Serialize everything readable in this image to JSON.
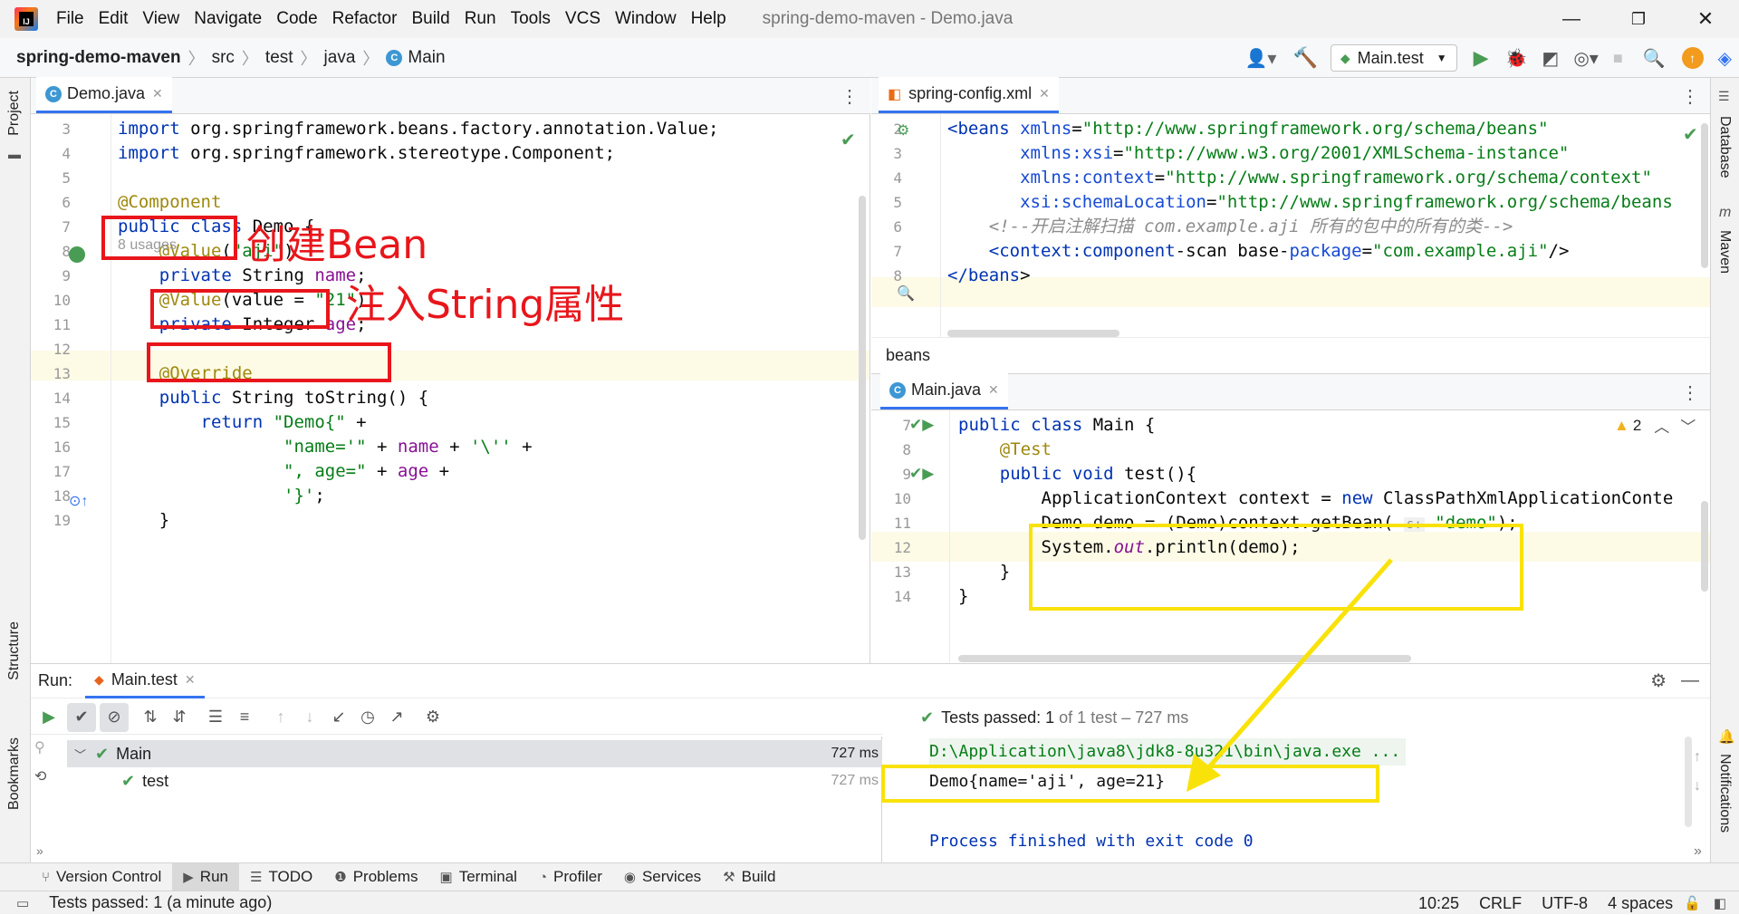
{
  "title_bar": {
    "menu": [
      "File",
      "Edit",
      "View",
      "Navigate",
      "Code",
      "Refactor",
      "Build",
      "Run",
      "Tools",
      "VCS",
      "Window",
      "Help"
    ],
    "window_title": "spring-demo-maven - Demo.java"
  },
  "nav_bar": {
    "project": "spring-demo-maven",
    "crumbs": [
      "src",
      "test",
      "java",
      "Main"
    ],
    "run_config": "Main.test"
  },
  "side_stripes": {
    "left": [
      "Project",
      "Structure",
      "Bookmarks"
    ],
    "right": [
      "Database",
      "Maven",
      "Notifications"
    ]
  },
  "left_editor": {
    "tab": "Demo.java",
    "usages": "8 usages",
    "lines": [
      {
        "n": "3",
        "code": "import org.springframework.beans.factory.annotation.Value;"
      },
      {
        "n": "4",
        "code": "import org.springframework.stereotype.Component;"
      },
      {
        "n": "5",
        "code": ""
      },
      {
        "n": "6",
        "code": "@Component"
      },
      {
        "n": "7",
        "code": "public class Demo {"
      },
      {
        "n": "8",
        "code": "    @Value(\"aji\")"
      },
      {
        "n": "9",
        "code": "    private String name;"
      },
      {
        "n": "10",
        "code": "    @Value(value = \"21\")"
      },
      {
        "n": "11",
        "code": "    private Integer age;"
      },
      {
        "n": "12",
        "code": ""
      },
      {
        "n": "13",
        "code": "    @Override"
      },
      {
        "n": "14",
        "code": "    public String toString() {"
      },
      {
        "n": "15",
        "code": "        return \"Demo{\" +"
      },
      {
        "n": "16",
        "code": "                \"name='\" + name + '\\'' +"
      },
      {
        "n": "17",
        "code": "                \", age=\" + age +"
      },
      {
        "n": "18",
        "code": "                '}';"
      },
      {
        "n": "19",
        "code": "    }"
      }
    ],
    "annotations": {
      "create_bean": "创建Bean",
      "inject_string": "注入String属性"
    }
  },
  "right_top_editor": {
    "tab": "spring-config.xml",
    "breadcrumb": "beans",
    "lines": [
      {
        "n": "2",
        "code": "<beans xmlns=\"http://www.springframework.org/schema/beans\""
      },
      {
        "n": "3",
        "code": "       xmlns:xsi=\"http://www.w3.org/2001/XMLSchema-instance\""
      },
      {
        "n": "4",
        "code": "       xmlns:context=\"http://www.springframework.org/schema/context\""
      },
      {
        "n": "5",
        "code": "       xsi:schemaLocation=\"http://www.springframework.org/schema/beans"
      },
      {
        "n": "6",
        "code": "    <!--开启注解扫描 com.example.aji 所有的包中的所有的类-->"
      },
      {
        "n": "7",
        "code": "    <context:component-scan base-package=\"com.example.aji\"/>"
      },
      {
        "n": "8",
        "code": "</beans>"
      }
    ]
  },
  "right_bottom_editor": {
    "tab": "Main.java",
    "warning_count": "2",
    "lines": [
      {
        "n": "7",
        "code": "public class Main {"
      },
      {
        "n": "8",
        "code": "    @Test"
      },
      {
        "n": "9",
        "code": "    public void test(){"
      },
      {
        "n": "10",
        "code": "        ApplicationContext context = new ClassPathXmlApplicationConte"
      },
      {
        "n": "11",
        "code": "        Demo demo = (Demo)context.getBean( s: \"demo\");"
      },
      {
        "n": "12",
        "code": "        System.out.println(demo);"
      },
      {
        "n": "13",
        "code": "    }"
      },
      {
        "n": "14",
        "code": "}"
      }
    ]
  },
  "run_panel": {
    "label": "Run:",
    "tab": "Main.test",
    "tests_passed": "Tests passed:",
    "tests_count": "1",
    "tests_detail": "of 1 test – 727 ms",
    "tree": [
      {
        "name": "Main",
        "time": "727 ms"
      },
      {
        "name": "test",
        "time": "727 ms"
      }
    ],
    "console": [
      "D:\\Application\\java8\\jdk8-8u321\\bin\\java.exe ...",
      "Demo{name='aji', age=21}",
      "",
      "Process finished with exit code 0"
    ]
  },
  "tool_windows": [
    "Version Control",
    "Run",
    "TODO",
    "Problems",
    "Terminal",
    "Profiler",
    "Services",
    "Build"
  ],
  "status_bar": {
    "message": "Tests passed: 1 (a minute ago)",
    "position": "10:25",
    "line_sep": "CRLF",
    "encoding": "UTF-8",
    "indent": "4 spaces"
  },
  "colors": {
    "annotation_red": "#e8161b",
    "highlight_yellow": "#f9e20a",
    "keyword": "#0033b3",
    "string": "#067d17",
    "success_green": "#499c54"
  }
}
